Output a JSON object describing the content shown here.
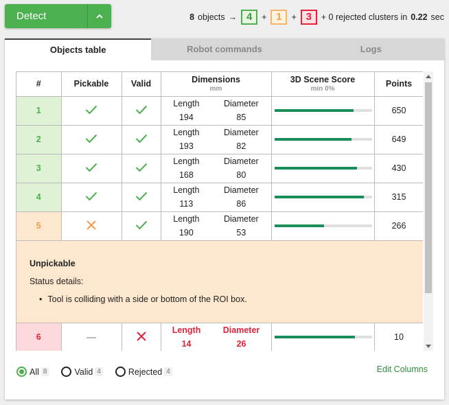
{
  "detect": {
    "label": "Detect"
  },
  "summary": {
    "total_count": "8",
    "total_label": "objects",
    "arrow": "→",
    "valid": "4",
    "plus1": "+",
    "unpickable": "1",
    "plus2": "+",
    "rejected": "3",
    "tail_text": "+ 0 rejected clusters in",
    "time": "0.22",
    "time_unit": "sec"
  },
  "tabs": [
    {
      "label": "Objects table",
      "active": true
    },
    {
      "label": "Robot commands",
      "active": false
    },
    {
      "label": "Logs",
      "active": false
    }
  ],
  "table": {
    "headers": {
      "idx": "#",
      "pickable": "Pickable",
      "valid": "Valid",
      "dimensions": "Dimensions",
      "dimensions_unit": "mm",
      "score": "3D Scene Score",
      "score_sub": "min 0%",
      "points": "Points"
    },
    "dim_labels": {
      "length": "Length",
      "diameter": "Diameter"
    },
    "rows": [
      {
        "idx": "1",
        "status": "valid",
        "pickable": "check",
        "valid": "check",
        "length": "194",
        "diameter": "85",
        "score": 0.81,
        "points": "650"
      },
      {
        "idx": "2",
        "status": "valid",
        "pickable": "check",
        "valid": "check",
        "length": "193",
        "diameter": "82",
        "score": 0.79,
        "points": "649"
      },
      {
        "idx": "3",
        "status": "valid",
        "pickable": "check",
        "valid": "check",
        "length": "168",
        "diameter": "80",
        "score": 0.85,
        "points": "430"
      },
      {
        "idx": "4",
        "status": "valid",
        "pickable": "check",
        "valid": "check",
        "length": "113",
        "diameter": "86",
        "score": 0.92,
        "points": "315"
      },
      {
        "idx": "5",
        "status": "unpickable",
        "pickable": "cross",
        "valid": "check",
        "length": "190",
        "diameter": "53",
        "score": 0.51,
        "points": "266"
      },
      {
        "idx": "6",
        "status": "rejected",
        "pickable": "dash",
        "valid": "cross",
        "length": "14",
        "diameter": "26",
        "score": 0.83,
        "points": "10"
      }
    ],
    "detail": {
      "title": "Unpickable",
      "status_label": "Status details:",
      "items": [
        "Tool is colliding with a side or bottom of the ROI box."
      ]
    }
  },
  "filters": [
    {
      "label": "All",
      "count": "8",
      "selected": true
    },
    {
      "label": "Valid",
      "count": "4",
      "selected": false
    },
    {
      "label": "Rejected",
      "count": "4",
      "selected": false
    }
  ],
  "edit_columns": "Edit Columns",
  "colors": {
    "valid": "#4caf50",
    "unpickable": "#f09a4b",
    "rejected": "#e0213a",
    "score_bar": "#1b8c5a"
  }
}
